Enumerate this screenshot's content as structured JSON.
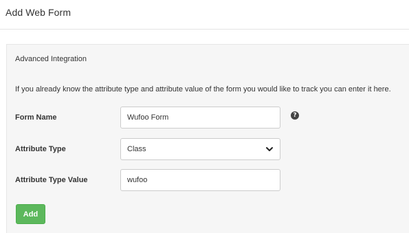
{
  "header": {
    "title": "Add Web Form"
  },
  "panel": {
    "section_title": "Advanced Integration",
    "help_text": "If you already know the attribute type and attribute value of the form you would like to track you can enter it here.",
    "help_icon_glyph": "?",
    "fields": {
      "form_name": {
        "label": "Form Name",
        "value": "Wufoo Form"
      },
      "attribute_type": {
        "label": "Attribute Type",
        "selected": "Class"
      },
      "attribute_type_value": {
        "label": "Attribute Type Value",
        "value": "wufoo"
      }
    },
    "add_button_label": "Add"
  },
  "colors": {
    "primary_button": "#5cb85c",
    "panel_background": "#f6f6f6",
    "input_border": "#cccccc"
  },
  "icons": {
    "help": "question-circle-icon",
    "select_arrow": "chevron-down-icon"
  }
}
